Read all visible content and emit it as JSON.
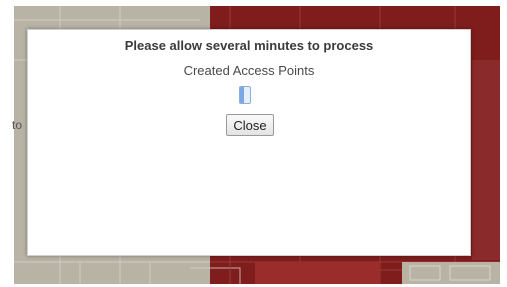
{
  "map": {
    "colors": {
      "parcel_red": "#7f1d1d",
      "base_gray": "#b9b3a6",
      "road_line": "#d9d4c8"
    },
    "edge_text": "to"
  },
  "dialog": {
    "title": "Please allow several minutes to process",
    "status": "Created Access Points",
    "progress_fraction": 0.35,
    "close_label": "Close"
  }
}
